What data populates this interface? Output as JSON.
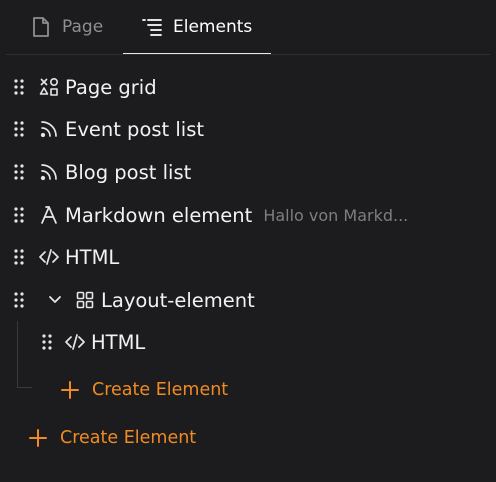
{
  "tabs": [
    {
      "label": "Page",
      "icon": "page-icon",
      "active": false
    },
    {
      "label": "Elements",
      "icon": "list-tree-icon",
      "active": true
    }
  ],
  "elements": [
    {
      "label": "Page grid",
      "icon": "shapes-grid-icon",
      "subtitle": ""
    },
    {
      "label": "Event post list",
      "icon": "rss-icon",
      "subtitle": ""
    },
    {
      "label": "Blog post list",
      "icon": "rss-icon",
      "subtitle": ""
    },
    {
      "label": "Markdown element",
      "icon": "typography-icon",
      "subtitle": "Hallo von Markd..."
    },
    {
      "label": "HTML",
      "icon": "code-icon",
      "subtitle": ""
    },
    {
      "label": "Layout-element",
      "icon": "layout-grid-icon",
      "subtitle": "",
      "expanded": true,
      "children": [
        {
          "label": "HTML",
          "icon": "code-icon"
        }
      ],
      "create_label": "Create Element"
    }
  ],
  "create_label": "Create Element",
  "colors": {
    "accent": "#f08a24",
    "background": "#1c1c1e",
    "text": "#f2f2f2",
    "muted": "#7d7d82"
  }
}
